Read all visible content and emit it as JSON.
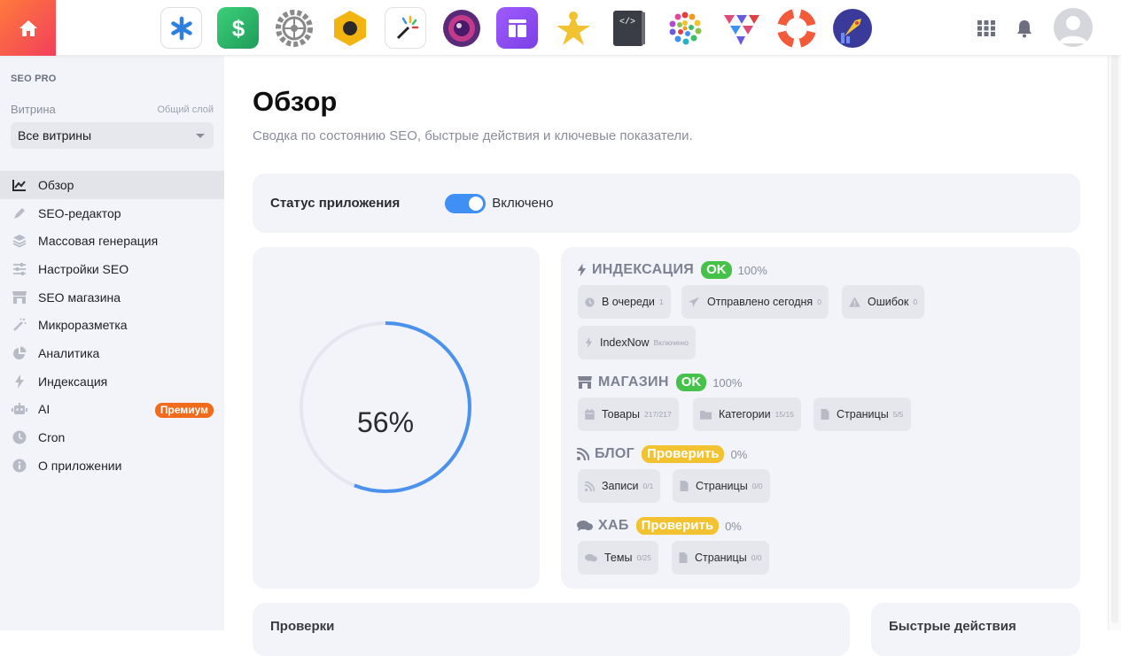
{
  "topbar": {
    "apps": [
      {
        "name": "asterisk-app-icon"
      },
      {
        "name": "dollar-app-icon"
      },
      {
        "name": "gear-app-icon"
      },
      {
        "name": "hexagon-app-icon"
      },
      {
        "name": "magic-wand-app-icon"
      },
      {
        "name": "camera-lens-app-icon"
      },
      {
        "name": "layout-app-icon"
      },
      {
        "name": "star-person-app-icon"
      },
      {
        "name": "code-book-app-icon"
      },
      {
        "name": "mosaic-app-icon"
      },
      {
        "name": "triangles-app-icon"
      },
      {
        "name": "lifebuoy-app-icon"
      },
      {
        "name": "rocket-app-icon"
      },
      {
        "name": "partial-app-icon"
      }
    ]
  },
  "sidebar": {
    "brand": "SEO PRO",
    "storefront_label": "Витрина",
    "layer_label": "Общий слой",
    "storefront_value": "Все витрины",
    "items": [
      {
        "label": "Обзор",
        "icon": "chart-line-icon"
      },
      {
        "label": "SEO-редактор",
        "icon": "pen-icon"
      },
      {
        "label": "Массовая генерация",
        "icon": "layers-icon"
      },
      {
        "label": "Настройки SEO",
        "icon": "sliders-icon"
      },
      {
        "label": "SEO магазина",
        "icon": "store-icon"
      },
      {
        "label": "Микроразметка",
        "icon": "wand-icon"
      },
      {
        "label": "Аналитика",
        "icon": "pie-chart-icon"
      },
      {
        "label": "Индексация",
        "icon": "bolt-icon"
      },
      {
        "label": "AI",
        "icon": "robot-icon",
        "badge": "Премиум"
      },
      {
        "label": "Cron",
        "icon": "clock-icon"
      },
      {
        "label": "О приложении",
        "icon": "info-icon"
      }
    ]
  },
  "main": {
    "title": "Обзор",
    "subtitle": "Сводка по состоянию SEO, быстрые действия и ключевые показатели.",
    "status": {
      "label": "Статус приложения",
      "toggle_on": true,
      "toggle_text": "Включено"
    },
    "gauge": {
      "percent": 56,
      "label": "56%"
    },
    "sections": [
      {
        "name": "ИНДЕКСАЦИЯ",
        "icon": "bolt-icon",
        "badge": "OK",
        "badge_color": "#46c24a",
        "pct": "100%",
        "chips": [
          {
            "label": "В очереди",
            "count": "1",
            "icon": "clock-icon"
          },
          {
            "label": "Отправлено сегодня",
            "count": "0",
            "icon": "send-icon"
          },
          {
            "label": "Ошибок",
            "count": "0",
            "icon": "warning-icon"
          },
          {
            "label": "IndexNow",
            "count": "Включено",
            "icon": "bolt-icon"
          }
        ]
      },
      {
        "name": "МАГАЗИН",
        "icon": "store-icon",
        "badge": "OK",
        "badge_color": "#46c24a",
        "pct": "100%",
        "chips": [
          {
            "label": "Товары",
            "count": "217/217",
            "icon": "calendar-icon"
          },
          {
            "label": "Категории",
            "count": "15/15",
            "icon": "folder-icon"
          },
          {
            "label": "Страницы",
            "count": "5/5",
            "icon": "file-icon"
          }
        ]
      },
      {
        "name": "БЛОГ",
        "icon": "rss-icon",
        "badge": "Проверить",
        "badge_color": "#f2c230",
        "pct": "0%",
        "chips": [
          {
            "label": "Записи",
            "count": "0/1",
            "icon": "rss-icon"
          },
          {
            "label": "Страницы",
            "count": "0/0",
            "icon": "file-icon"
          }
        ]
      },
      {
        "name": "ХАБ",
        "icon": "comments-icon",
        "badge": "Проверить",
        "badge_color": "#f2c230",
        "pct": "0%",
        "chips": [
          {
            "label": "Темы",
            "count": "0/25",
            "icon": "comments-icon"
          },
          {
            "label": "Страницы",
            "count": "0/0",
            "icon": "file-icon"
          }
        ]
      }
    ],
    "checks_title": "Проверки",
    "quick_title": "Быстрые действия"
  },
  "colors": {
    "accent": "#3f8ff5",
    "ok": "#46c24a",
    "warn": "#f2c230",
    "premium": "#f26b1d"
  }
}
